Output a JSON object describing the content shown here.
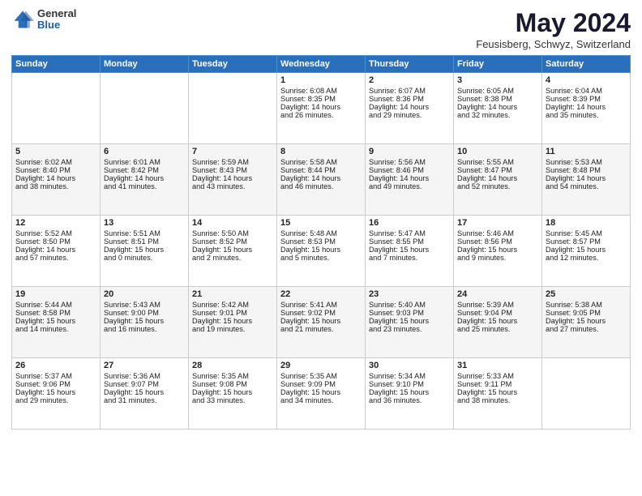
{
  "logo": {
    "general": "General",
    "blue": "Blue"
  },
  "header": {
    "month": "May 2024",
    "location": "Feusisberg, Schwyz, Switzerland"
  },
  "weekdays": [
    "Sunday",
    "Monday",
    "Tuesday",
    "Wednesday",
    "Thursday",
    "Friday",
    "Saturday"
  ],
  "weeks": [
    [
      {
        "day": "",
        "info": ""
      },
      {
        "day": "",
        "info": ""
      },
      {
        "day": "",
        "info": ""
      },
      {
        "day": "1",
        "info": "Sunrise: 6:08 AM\nSunset: 8:35 PM\nDaylight: 14 hours\nand 26 minutes."
      },
      {
        "day": "2",
        "info": "Sunrise: 6:07 AM\nSunset: 8:36 PM\nDaylight: 14 hours\nand 29 minutes."
      },
      {
        "day": "3",
        "info": "Sunrise: 6:05 AM\nSunset: 8:38 PM\nDaylight: 14 hours\nand 32 minutes."
      },
      {
        "day": "4",
        "info": "Sunrise: 6:04 AM\nSunset: 8:39 PM\nDaylight: 14 hours\nand 35 minutes."
      }
    ],
    [
      {
        "day": "5",
        "info": "Sunrise: 6:02 AM\nSunset: 8:40 PM\nDaylight: 14 hours\nand 38 minutes."
      },
      {
        "day": "6",
        "info": "Sunrise: 6:01 AM\nSunset: 8:42 PM\nDaylight: 14 hours\nand 41 minutes."
      },
      {
        "day": "7",
        "info": "Sunrise: 5:59 AM\nSunset: 8:43 PM\nDaylight: 14 hours\nand 43 minutes."
      },
      {
        "day": "8",
        "info": "Sunrise: 5:58 AM\nSunset: 8:44 PM\nDaylight: 14 hours\nand 46 minutes."
      },
      {
        "day": "9",
        "info": "Sunrise: 5:56 AM\nSunset: 8:46 PM\nDaylight: 14 hours\nand 49 minutes."
      },
      {
        "day": "10",
        "info": "Sunrise: 5:55 AM\nSunset: 8:47 PM\nDaylight: 14 hours\nand 52 minutes."
      },
      {
        "day": "11",
        "info": "Sunrise: 5:53 AM\nSunset: 8:48 PM\nDaylight: 14 hours\nand 54 minutes."
      }
    ],
    [
      {
        "day": "12",
        "info": "Sunrise: 5:52 AM\nSunset: 8:50 PM\nDaylight: 14 hours\nand 57 minutes."
      },
      {
        "day": "13",
        "info": "Sunrise: 5:51 AM\nSunset: 8:51 PM\nDaylight: 15 hours\nand 0 minutes."
      },
      {
        "day": "14",
        "info": "Sunrise: 5:50 AM\nSunset: 8:52 PM\nDaylight: 15 hours\nand 2 minutes."
      },
      {
        "day": "15",
        "info": "Sunrise: 5:48 AM\nSunset: 8:53 PM\nDaylight: 15 hours\nand 5 minutes."
      },
      {
        "day": "16",
        "info": "Sunrise: 5:47 AM\nSunset: 8:55 PM\nDaylight: 15 hours\nand 7 minutes."
      },
      {
        "day": "17",
        "info": "Sunrise: 5:46 AM\nSunset: 8:56 PM\nDaylight: 15 hours\nand 9 minutes."
      },
      {
        "day": "18",
        "info": "Sunrise: 5:45 AM\nSunset: 8:57 PM\nDaylight: 15 hours\nand 12 minutes."
      }
    ],
    [
      {
        "day": "19",
        "info": "Sunrise: 5:44 AM\nSunset: 8:58 PM\nDaylight: 15 hours\nand 14 minutes."
      },
      {
        "day": "20",
        "info": "Sunrise: 5:43 AM\nSunset: 9:00 PM\nDaylight: 15 hours\nand 16 minutes."
      },
      {
        "day": "21",
        "info": "Sunrise: 5:42 AM\nSunset: 9:01 PM\nDaylight: 15 hours\nand 19 minutes."
      },
      {
        "day": "22",
        "info": "Sunrise: 5:41 AM\nSunset: 9:02 PM\nDaylight: 15 hours\nand 21 minutes."
      },
      {
        "day": "23",
        "info": "Sunrise: 5:40 AM\nSunset: 9:03 PM\nDaylight: 15 hours\nand 23 minutes."
      },
      {
        "day": "24",
        "info": "Sunrise: 5:39 AM\nSunset: 9:04 PM\nDaylight: 15 hours\nand 25 minutes."
      },
      {
        "day": "25",
        "info": "Sunrise: 5:38 AM\nSunset: 9:05 PM\nDaylight: 15 hours\nand 27 minutes."
      }
    ],
    [
      {
        "day": "26",
        "info": "Sunrise: 5:37 AM\nSunset: 9:06 PM\nDaylight: 15 hours\nand 29 minutes."
      },
      {
        "day": "27",
        "info": "Sunrise: 5:36 AM\nSunset: 9:07 PM\nDaylight: 15 hours\nand 31 minutes."
      },
      {
        "day": "28",
        "info": "Sunrise: 5:35 AM\nSunset: 9:08 PM\nDaylight: 15 hours\nand 33 minutes."
      },
      {
        "day": "29",
        "info": "Sunrise: 5:35 AM\nSunset: 9:09 PM\nDaylight: 15 hours\nand 34 minutes."
      },
      {
        "day": "30",
        "info": "Sunrise: 5:34 AM\nSunset: 9:10 PM\nDaylight: 15 hours\nand 36 minutes."
      },
      {
        "day": "31",
        "info": "Sunrise: 5:33 AM\nSunset: 9:11 PM\nDaylight: 15 hours\nand 38 minutes."
      },
      {
        "day": "",
        "info": ""
      }
    ]
  ]
}
